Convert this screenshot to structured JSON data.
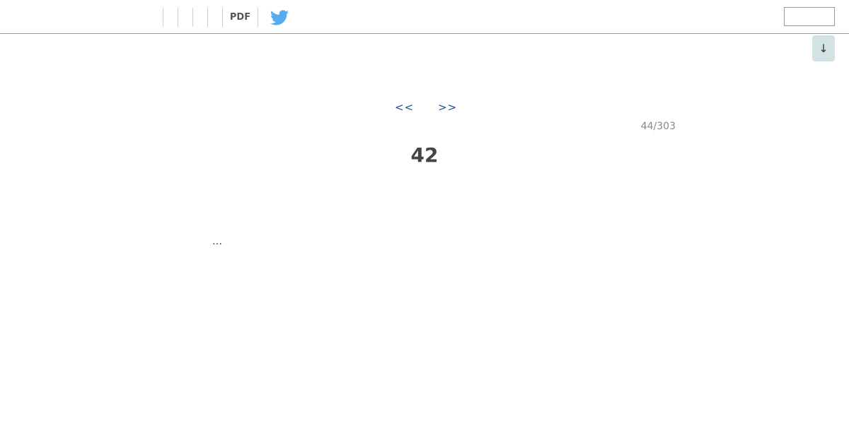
{
  "toolbar": {
    "pdf_label": "PDF",
    "twitter_icon": "twitter-bird-icon",
    "search_value": ""
  },
  "scroll_button": {
    "label": "↓"
  },
  "pagination": {
    "prev_label": "<<",
    "next_label": ">>",
    "counter": "44/303"
  },
  "content": {
    "heading": "42",
    "text": "…"
  },
  "colors": {
    "link": "#1a4f9c",
    "twitter": "#55acee",
    "scroll_button_bg": "#d3e2e3",
    "counter_text": "#888888"
  }
}
